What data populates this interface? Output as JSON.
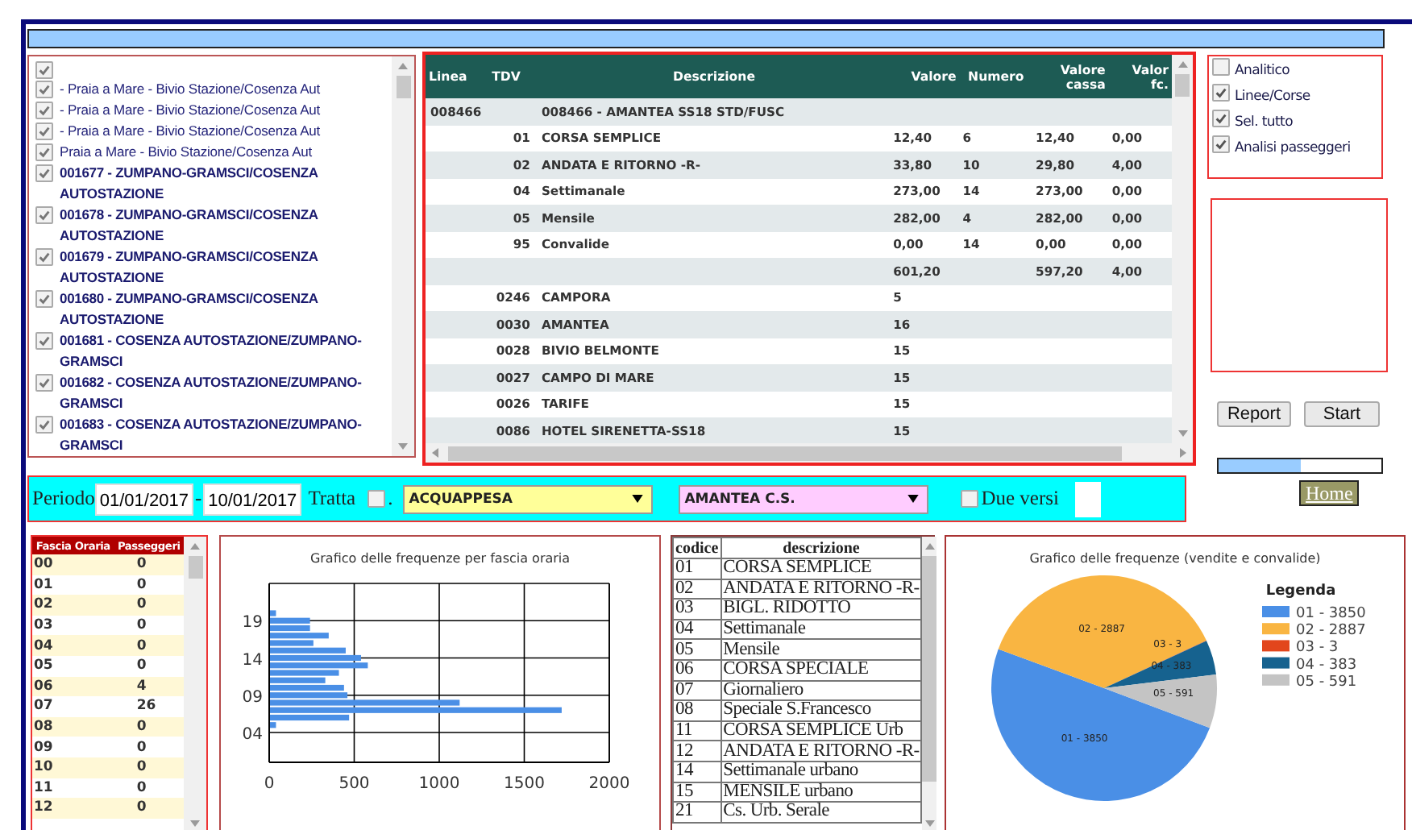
{
  "routes": {
    "items": [
      {
        "checked": true
      },
      {
        "label": "- Praia a Mare - Bivio Stazione/Cosenza Aut",
        "checked": true
      },
      {
        "label": "- Praia a Mare - Bivio Stazione/Cosenza Aut",
        "checked": true
      },
      {
        "label": "- Praia a Mare - Bivio Stazione/Cosenza Aut",
        "checked": true
      },
      {
        "label": "Praia a Mare - Bivio Stazione/Cosenza Aut",
        "checked": true
      },
      {
        "label": "001677 - ZUMPANO-GRAMSCI/COSENZA AUTOSTAZIONE",
        "checked": true
      },
      {
        "label": "001678 - ZUMPANO-GRAMSCI/COSENZA AUTOSTAZIONE",
        "checked": true
      },
      {
        "label": "001679 - ZUMPANO-GRAMSCI/COSENZA AUTOSTAZIONE",
        "checked": true
      },
      {
        "label": "001680 - ZUMPANO-GRAMSCI/COSENZA AUTOSTAZIONE",
        "checked": true
      },
      {
        "label": "001681 - COSENZA AUTOSTAZIONE/ZUMPANO-GRAMSCI",
        "checked": true
      },
      {
        "label": "001682 - COSENZA AUTOSTAZIONE/ZUMPANO-GRAMSCI",
        "checked": true
      },
      {
        "label": "001683 - COSENZA AUTOSTAZIONE/ZUMPANO-GRAMSCI",
        "checked": true
      }
    ]
  },
  "table": {
    "columns": [
      "Linea",
      "TDV",
      "Descrizione",
      "Valore",
      "Numero",
      "Valore cassa",
      "Valor fc."
    ],
    "rows": [
      {
        "linea": "008466",
        "descrizione": "008466 - AMANTEA SS18 STD/FUSC"
      },
      {
        "tdv": "01",
        "descrizione": "CORSA SEMPLICE",
        "valore": "12,40",
        "numero": "6",
        "valore_cassa": "12,40",
        "valore_fc": "0,00"
      },
      {
        "tdv": "02",
        "descrizione": "ANDATA E RITORNO -R-",
        "valore": "33,80",
        "numero": "10",
        "valore_cassa": "29,80",
        "valore_fc": "4,00"
      },
      {
        "tdv": "04",
        "descrizione": "Settimanale",
        "valore": "273,00",
        "numero": "14",
        "valore_cassa": "273,00",
        "valore_fc": "0,00"
      },
      {
        "tdv": "05",
        "descrizione": "Mensile",
        "valore": "282,00",
        "numero": "4",
        "valore_cassa": "282,00",
        "valore_fc": "0,00"
      },
      {
        "tdv": "95",
        "descrizione": "Convalide",
        "valore": "0,00",
        "numero": "14",
        "valore_cassa": "0,00",
        "valore_fc": "0,00"
      },
      {
        "valore": "601,20",
        "valore_cassa": "597,20",
        "valore_fc": "4,00"
      },
      {
        "tdv": "0246",
        "descrizione": "CAMPORA",
        "valore": "5"
      },
      {
        "tdv": "0030",
        "descrizione": "AMANTEA",
        "valore": "16"
      },
      {
        "tdv": "0028",
        "descrizione": "BIVIO BELMONTE",
        "valore": "15"
      },
      {
        "tdv": "0027",
        "descrizione": "CAMPO DI MARE",
        "valore": "15"
      },
      {
        "tdv": "0026",
        "descrizione": "TARIFE",
        "valore": "15"
      },
      {
        "tdv": "0086",
        "descrizione": "HOTEL SIRENETTA-SS18",
        "valore": "15"
      }
    ]
  },
  "options": [
    {
      "label": "Analitico",
      "checked": false
    },
    {
      "label": "Linee/Corse",
      "checked": true
    },
    {
      "label": "Sel. tutto",
      "checked": true
    },
    {
      "label": "Analisi passeggeri",
      "checked": true
    }
  ],
  "buttons": [
    "Report",
    "Start"
  ],
  "progress": {
    "level": 0.5
  },
  "filter": {
    "period_label": "Periodo",
    "date_from": "01/01/2017",
    "separator": "-",
    "date_to": "10/01/2017",
    "tratta_label": "Tratta",
    "tratta_checked": false,
    "dot": ".",
    "from_stop": "ACQUAPPESA",
    "to_stop": "AMANTEA C.S.",
    "due_versi_label": "Due versi",
    "due_versi_checked": false
  },
  "home_link": "Home",
  "hourly": {
    "columns": [
      "Fascia Oraria",
      "Passeggeri"
    ],
    "rows": [
      {
        "fascia": "00",
        "passeggeri": "0"
      },
      {
        "fascia": "01",
        "passeggeri": "0"
      },
      {
        "fascia": "02",
        "passeggeri": "0"
      },
      {
        "fascia": "03",
        "passeggeri": "0"
      },
      {
        "fascia": "04",
        "passeggeri": "0"
      },
      {
        "fascia": "05",
        "passeggeri": "0"
      },
      {
        "fascia": "06",
        "passeggeri": "4"
      },
      {
        "fascia": "07",
        "passeggeri": "26"
      },
      {
        "fascia": "08",
        "passeggeri": "0"
      },
      {
        "fascia": "09",
        "passeggeri": "0"
      },
      {
        "fascia": "10",
        "passeggeri": "0"
      },
      {
        "fascia": "11",
        "passeggeri": "0"
      },
      {
        "fascia": "12",
        "passeggeri": "0"
      }
    ]
  },
  "hourly_chart": {
    "chart_data": {
      "type": "bar",
      "orientation": "horizontal",
      "title": "Grafico delle frequenze per fascia oraria",
      "x": [
        5,
        6,
        7,
        8,
        9,
        10,
        11,
        12,
        13,
        14,
        15,
        16,
        17,
        18,
        19,
        20
      ],
      "values": [
        40,
        470,
        1720,
        1120,
        460,
        440,
        330,
        410,
        580,
        540,
        450,
        260,
        350,
        240,
        240,
        40
      ],
      "grid": true,
      "xlim": [
        0,
        2000
      ],
      "xticks": [
        0,
        500,
        1000,
        1500,
        2000
      ],
      "ylim": [
        0,
        24
      ],
      "yticks": [
        {
          "value": 4,
          "label": "04"
        },
        {
          "value": 9,
          "label": "09"
        },
        {
          "value": 14,
          "label": "14"
        },
        {
          "value": 19,
          "label": "19"
        }
      ]
    }
  },
  "codes": {
    "columns": [
      "codice",
      "descrizione"
    ],
    "rows": [
      {
        "codice": "01",
        "descrizione": "CORSA SEMPLICE"
      },
      {
        "codice": "02",
        "descrizione": "ANDATA E RITORNO -R-"
      },
      {
        "codice": "03",
        "descrizione": "BIGL. RIDOTTO"
      },
      {
        "codice": "04",
        "descrizione": "Settimanale"
      },
      {
        "codice": "05",
        "descrizione": "Mensile"
      },
      {
        "codice": "06",
        "descrizione": "CORSA SPECIALE"
      },
      {
        "codice": "07",
        "descrizione": "Giornaliero"
      },
      {
        "codice": "08",
        "descrizione": "Speciale S.Francesco"
      },
      {
        "codice": "11",
        "descrizione": "CORSA SEMPLICE Urb"
      },
      {
        "codice": "12",
        "descrizione": "ANDATA E RITORNO -R-"
      },
      {
        "codice": "14",
        "descrizione": "Settimanale urbano"
      },
      {
        "codice": "15",
        "descrizione": "MENSILE urbano"
      },
      {
        "codice": "21",
        "descrizione": "Cs. Urb. Serale"
      }
    ]
  },
  "sales_chart": {
    "chart_data": {
      "legend": {
        "title": "Legenda"
      },
      "type": "pie",
      "title": "Grafico delle frequenze (vendite e convalide)",
      "categories": [
        "01 - 3850",
        "02 - 2887",
        "03 - 3",
        "04 - 383",
        "05 - 591"
      ],
      "values": [
        3850,
        2887,
        3,
        383,
        591
      ],
      "colors": [
        "#4a8fe6",
        "#f9b542",
        "#e2461c",
        "#16628f",
        "#c4c4c4"
      ]
    }
  }
}
